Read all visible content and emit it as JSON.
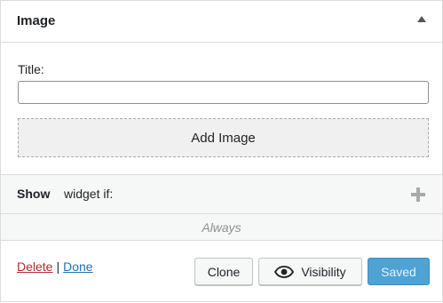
{
  "widget": {
    "title": "Image",
    "toggle_icon": "collapse-arrow-icon"
  },
  "form": {
    "title_label": "Title:",
    "title_value": "",
    "add_image_label": "Add Image"
  },
  "visibility": {
    "show_label": "Show",
    "condition_text": "widget if:",
    "add_icon": "plus-icon",
    "always_text": "Always"
  },
  "footer": {
    "delete_label": "Delete",
    "separator": "|",
    "done_label": "Done",
    "clone_label": "Clone",
    "visibility_label": "Visibility",
    "visibility_icon": "eye-icon",
    "saved_label": "Saved"
  },
  "colors": {
    "delete_link": "#b32d2e",
    "done_link": "#2271b1",
    "saved_button": "#4fa2d4"
  }
}
